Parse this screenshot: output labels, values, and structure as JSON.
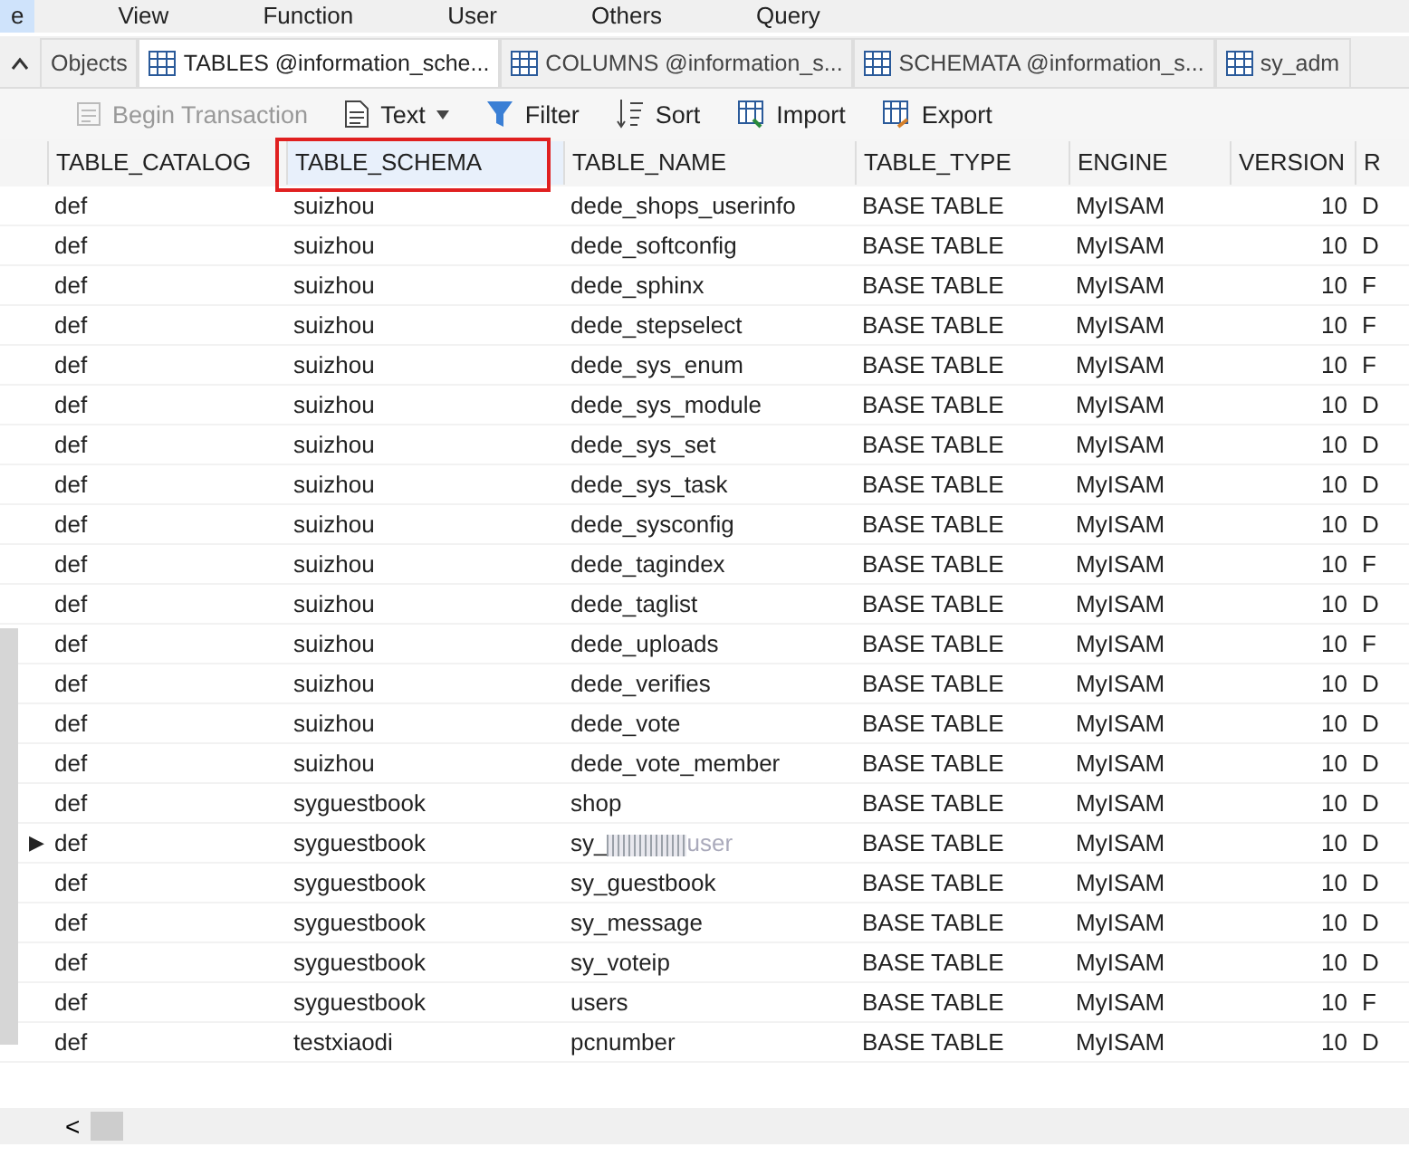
{
  "menu": [
    {
      "label": "e",
      "selected": true
    },
    {
      "label": "View",
      "selected": false
    },
    {
      "label": "Function",
      "selected": false
    },
    {
      "label": "User",
      "selected": false
    },
    {
      "label": "Others",
      "selected": false
    },
    {
      "label": "Query",
      "selected": false
    }
  ],
  "tabs": [
    {
      "label": "Objects",
      "kind": "plain",
      "selected": false
    },
    {
      "label": "TABLES @information_sche...",
      "kind": "table",
      "selected": true
    },
    {
      "label": "COLUMNS @information_s...",
      "kind": "table",
      "selected": false
    },
    {
      "label": "SCHEMATA @information_s...",
      "kind": "table",
      "selected": false
    },
    {
      "label": "sy_adm",
      "kind": "table",
      "selected": false
    }
  ],
  "toolbar": [
    {
      "label": "Begin Transaction",
      "kind": "transaction",
      "disabled": true
    },
    {
      "label": "Text",
      "kind": "text",
      "disabled": false
    },
    {
      "label": "Filter",
      "kind": "filter",
      "disabled": false
    },
    {
      "label": "Sort",
      "kind": "sort",
      "disabled": false
    },
    {
      "label": "Import",
      "kind": "import",
      "disabled": false
    },
    {
      "label": "Export",
      "kind": "export",
      "disabled": false
    }
  ],
  "table": {
    "columns": [
      {
        "label": "TABLE_CATALOG",
        "highlighted": false
      },
      {
        "label": "TABLE_SCHEMA",
        "highlighted": true
      },
      {
        "label": "TABLE_NAME",
        "highlighted": false
      },
      {
        "label": "TABLE_TYPE",
        "highlighted": false
      },
      {
        "label": "ENGINE",
        "highlighted": false
      },
      {
        "label": "VERSION",
        "highlighted": false
      },
      {
        "label": "R",
        "highlighted": false
      }
    ],
    "rows": [
      {
        "cells": [
          "def",
          "suizhou",
          "dede_shops_userinfo",
          "BASE TABLE",
          "MyISAM",
          "10",
          "D"
        ],
        "selected": false
      },
      {
        "cells": [
          "def",
          "suizhou",
          "dede_softconfig",
          "BASE TABLE",
          "MyISAM",
          "10",
          "D"
        ],
        "selected": false
      },
      {
        "cells": [
          "def",
          "suizhou",
          "dede_sphinx",
          "BASE TABLE",
          "MyISAM",
          "10",
          "F"
        ],
        "selected": false
      },
      {
        "cells": [
          "def",
          "suizhou",
          "dede_stepselect",
          "BASE TABLE",
          "MyISAM",
          "10",
          "F"
        ],
        "selected": false
      },
      {
        "cells": [
          "def",
          "suizhou",
          "dede_sys_enum",
          "BASE TABLE",
          "MyISAM",
          "10",
          "F"
        ],
        "selected": false
      },
      {
        "cells": [
          "def",
          "suizhou",
          "dede_sys_module",
          "BASE TABLE",
          "MyISAM",
          "10",
          "D"
        ],
        "selected": false
      },
      {
        "cells": [
          "def",
          "suizhou",
          "dede_sys_set",
          "BASE TABLE",
          "MyISAM",
          "10",
          "D"
        ],
        "selected": false
      },
      {
        "cells": [
          "def",
          "suizhou",
          "dede_sys_task",
          "BASE TABLE",
          "MyISAM",
          "10",
          "D"
        ],
        "selected": false
      },
      {
        "cells": [
          "def",
          "suizhou",
          "dede_sysconfig",
          "BASE TABLE",
          "MyISAM",
          "10",
          "D"
        ],
        "selected": false
      },
      {
        "cells": [
          "def",
          "suizhou",
          "dede_tagindex",
          "BASE TABLE",
          "MyISAM",
          "10",
          "F"
        ],
        "selected": false
      },
      {
        "cells": [
          "def",
          "suizhou",
          "dede_taglist",
          "BASE TABLE",
          "MyISAM",
          "10",
          "D"
        ],
        "selected": false
      },
      {
        "cells": [
          "def",
          "suizhou",
          "dede_uploads",
          "BASE TABLE",
          "MyISAM",
          "10",
          "F"
        ],
        "selected": false
      },
      {
        "cells": [
          "def",
          "suizhou",
          "dede_verifies",
          "BASE TABLE",
          "MyISAM",
          "10",
          "D"
        ],
        "selected": false
      },
      {
        "cells": [
          "def",
          "suizhou",
          "dede_vote",
          "BASE TABLE",
          "MyISAM",
          "10",
          "D"
        ],
        "selected": false
      },
      {
        "cells": [
          "def",
          "suizhou",
          "dede_vote_member",
          "BASE TABLE",
          "MyISAM",
          "10",
          "D"
        ],
        "selected": false
      },
      {
        "cells": [
          "def",
          "syguestbook",
          "shop",
          "BASE TABLE",
          "MyISAM",
          "10",
          "D"
        ],
        "selected": false
      },
      {
        "cells": [
          "def",
          "syguestbook",
          "sy_",
          "BASE TABLE",
          "MyISAM",
          "10",
          "D"
        ],
        "blurred_tail": "user",
        "selected": true
      },
      {
        "cells": [
          "def",
          "syguestbook",
          "sy_guestbook",
          "BASE TABLE",
          "MyISAM",
          "10",
          "D"
        ],
        "selected": false
      },
      {
        "cells": [
          "def",
          "syguestbook",
          "sy_message",
          "BASE TABLE",
          "MyISAM",
          "10",
          "D"
        ],
        "selected": false
      },
      {
        "cells": [
          "def",
          "syguestbook",
          "sy_voteip",
          "BASE TABLE",
          "MyISAM",
          "10",
          "D"
        ],
        "selected": false
      },
      {
        "cells": [
          "def",
          "syguestbook",
          "users",
          "BASE TABLE",
          "MyISAM",
          "10",
          "F"
        ],
        "selected": false
      },
      {
        "cells": [
          "def",
          "testxiaodi",
          "pcnumber",
          "BASE TABLE",
          "MyISAM",
          "10",
          "D"
        ],
        "selected": false
      }
    ]
  },
  "row_marker": "▶",
  "scroll_left": "<"
}
